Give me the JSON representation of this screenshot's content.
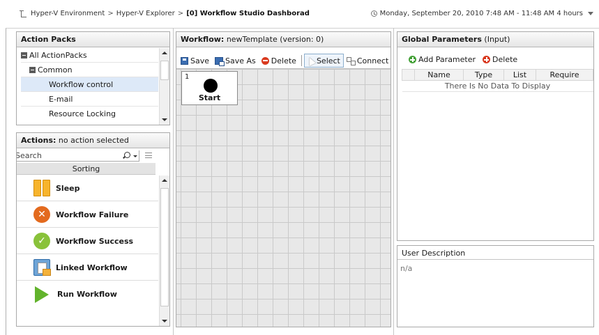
{
  "breadcrumb": {
    "items": [
      "Hyper-V Environment",
      "Hyper-V Explorer"
    ],
    "separator": ">",
    "current": "[0] Workflow Studio Dashborad"
  },
  "time_range": "Monday, September 20, 2010 7:48 AM - 11:48 AM 4 hours",
  "action_packs": {
    "title": "Action Packs",
    "items": [
      {
        "label": "All ActionPacks",
        "level": 0,
        "expanded": true,
        "selected": false
      },
      {
        "label": "Common",
        "level": 1,
        "expanded": true,
        "selected": false
      },
      {
        "label": "Workflow control",
        "level": 2,
        "selected": true
      },
      {
        "label": "E-mail",
        "level": 2,
        "selected": false
      },
      {
        "label": "Resource Locking",
        "level": 2,
        "selected": false
      }
    ]
  },
  "actions": {
    "title": "Actions:",
    "subtitle": "no action selected",
    "search_value": "Search",
    "sorting_label": "Sorting",
    "items": [
      {
        "label": "Sleep",
        "icon": "sleep-icon"
      },
      {
        "label": "Workflow Failure",
        "icon": "failure-icon"
      },
      {
        "label": "Workflow Success",
        "icon": "success-icon"
      },
      {
        "label": "Linked Workflow",
        "icon": "linked-workflow-icon"
      },
      {
        "label": "Run Workflow",
        "icon": "run-icon"
      }
    ]
  },
  "workflow": {
    "title": "Workflow:",
    "name": "newTemplate (version: 0)",
    "toolbar": {
      "save": "Save",
      "save_as": "Save As",
      "delete": "Delete",
      "select": "Select",
      "connect": "Connect"
    },
    "start_node": {
      "number": "1",
      "label": "Start"
    }
  },
  "global_parameters": {
    "title": "Global Parameters",
    "subtitle": "(Input)",
    "add_label": "Add Parameter",
    "delete_label": "Delete",
    "columns": [
      "",
      "Name",
      "Type",
      "List",
      "Require"
    ],
    "empty_text": "There Is No Data To Display"
  },
  "user_description": {
    "title": "User Description",
    "value": "n/a"
  },
  "colors": {
    "selected_row": "#dde9f8",
    "panel_border": "#a9a9a9",
    "canvas_bg": "#e8e8e8",
    "start_dot": "#000000"
  }
}
